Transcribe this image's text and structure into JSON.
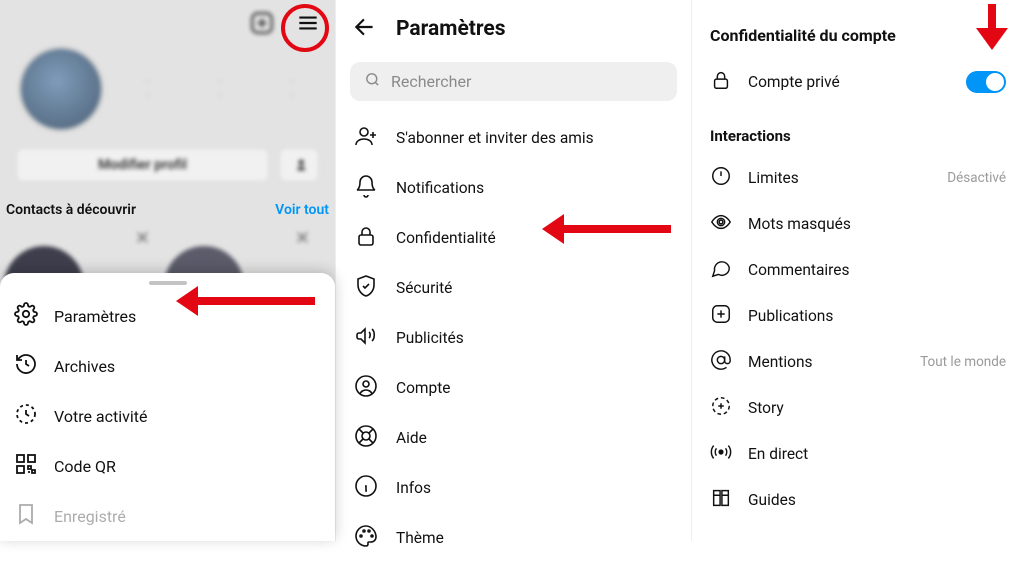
{
  "panel1": {
    "edit_profile": "Modifier profil",
    "discover_title": "Contacts à découvrir",
    "see_all": "Voir tout",
    "menu": [
      {
        "label": "Paramètres",
        "icon": "gear"
      },
      {
        "label": "Archives",
        "icon": "clock"
      },
      {
        "label": "Votre activité",
        "icon": "activity"
      },
      {
        "label": "Code QR",
        "icon": "qr"
      },
      {
        "label": "Enregistré",
        "icon": "bookmark"
      }
    ]
  },
  "panel2": {
    "title": "Paramètres",
    "search_placeholder": "Rechercher",
    "items": [
      {
        "label": "S'abonner et inviter des amis",
        "icon": "person-plus"
      },
      {
        "label": "Notifications",
        "icon": "bell"
      },
      {
        "label": "Confidentialité",
        "icon": "lock"
      },
      {
        "label": "Sécurité",
        "icon": "shield"
      },
      {
        "label": "Publicités",
        "icon": "megaphone"
      },
      {
        "label": "Compte",
        "icon": "user-circle"
      },
      {
        "label": "Aide",
        "icon": "lifebuoy"
      },
      {
        "label": "Infos",
        "icon": "info"
      },
      {
        "label": "Thème",
        "icon": "palette"
      }
    ]
  },
  "panel3": {
    "section_privacy": "Confidentialité du compte",
    "private_account": "Compte privé",
    "section_interactions": "Interactions",
    "interactions": [
      {
        "label": "Limites",
        "icon": "limits",
        "right": "Désactivé"
      },
      {
        "label": "Mots masqués",
        "icon": "eye"
      },
      {
        "label": "Commentaires",
        "icon": "comment"
      },
      {
        "label": "Publications",
        "icon": "plus-square"
      },
      {
        "label": "Mentions",
        "icon": "at",
        "right": "Tout le monde"
      },
      {
        "label": "Story",
        "icon": "story"
      },
      {
        "label": "En direct",
        "icon": "live"
      },
      {
        "label": "Guides",
        "icon": "guides"
      }
    ]
  }
}
